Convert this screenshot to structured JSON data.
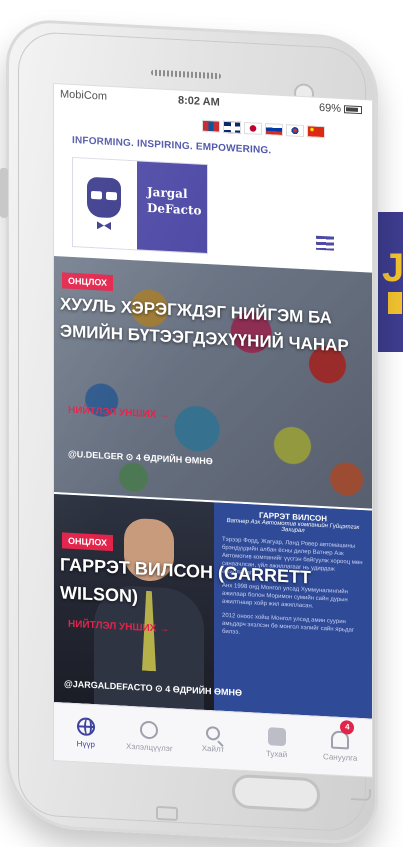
{
  "promo": {
    "text": "J"
  },
  "statusbar": {
    "carrier": "MobiCom",
    "time": "8:02 AM",
    "battery": "69%"
  },
  "flags": [
    "mongolia",
    "uk",
    "japan",
    "russia",
    "korea",
    "china"
  ],
  "tagline": "INFORMING. INSPIRING. EMPOWERING.",
  "logo": {
    "line1": "Jargal",
    "line2": "DeFacto"
  },
  "articles": [
    {
      "category": "ОНЦЛОХ",
      "headline": "ХУУЛЬ ХЭРЭГЖДЭГ НИЙГЭМ БА ЭМИЙН БҮТЭЭГДЭХҮҮНИЙ ЧАНАР",
      "readmore": "НИЙТЛЭЛ УНШИХ →",
      "author": "@U.DELGER",
      "time": "4 ӨДРИЙН ӨМНӨ"
    },
    {
      "category": "ОНЦЛОХ",
      "headline": "ГАРРЭТ ВИЛСОН (GARRETT WILSON)",
      "readmore": "НИЙТЛЭЛ УНШИХ →",
      "author": "@JARGALDEFACTO",
      "time": "4 ӨДРИЙН ӨМНӨ",
      "infobox": {
        "title": "ГАРРЭТ ВИЛСОН",
        "subtitle": "Ватнер Азк Автомотив компанийн Гүйцэтгэх Захирал",
        "bullets": [
          "Тэрээр Форд, Жагуар, Ланд Ровер автомашины брэндүүдийн албан ёсны дилер Ватнер Азк Автомотив компанийг үүсгэн байгуулж хорооц мөн санаачлсан, үйл ажиллагааг нь удирдаж ажилладаг.",
          "Анх 1998 онд Монгол улсад Хуммуналингийн ажилаар болон Моримон сумийн сайн дурын ажилтнаар хойр жил ажилласан.",
          "2012 оноос хойш Монгол улсад амин суурин амьдарч эхэлсэн бө монгол хэлийг сайн ярьдаг билээ."
        ]
      }
    }
  ],
  "nav": [
    {
      "label": "Нүүр",
      "icon": "globe-icon",
      "active": true
    },
    {
      "label": "Хэлэлцүүлэг",
      "icon": "chat-icon",
      "active": false
    },
    {
      "label": "Хайлт",
      "icon": "search-icon",
      "active": false
    },
    {
      "label": "Тухай",
      "icon": "about-icon",
      "active": false
    },
    {
      "label": "Сануулга",
      "icon": "bell-icon",
      "active": false,
      "badge": "4"
    }
  ],
  "colors": {
    "brand": "#4e4aa6",
    "accent": "#e2244b",
    "promo_bg": "#3d3c8f",
    "promo_text": "#f2c230"
  }
}
